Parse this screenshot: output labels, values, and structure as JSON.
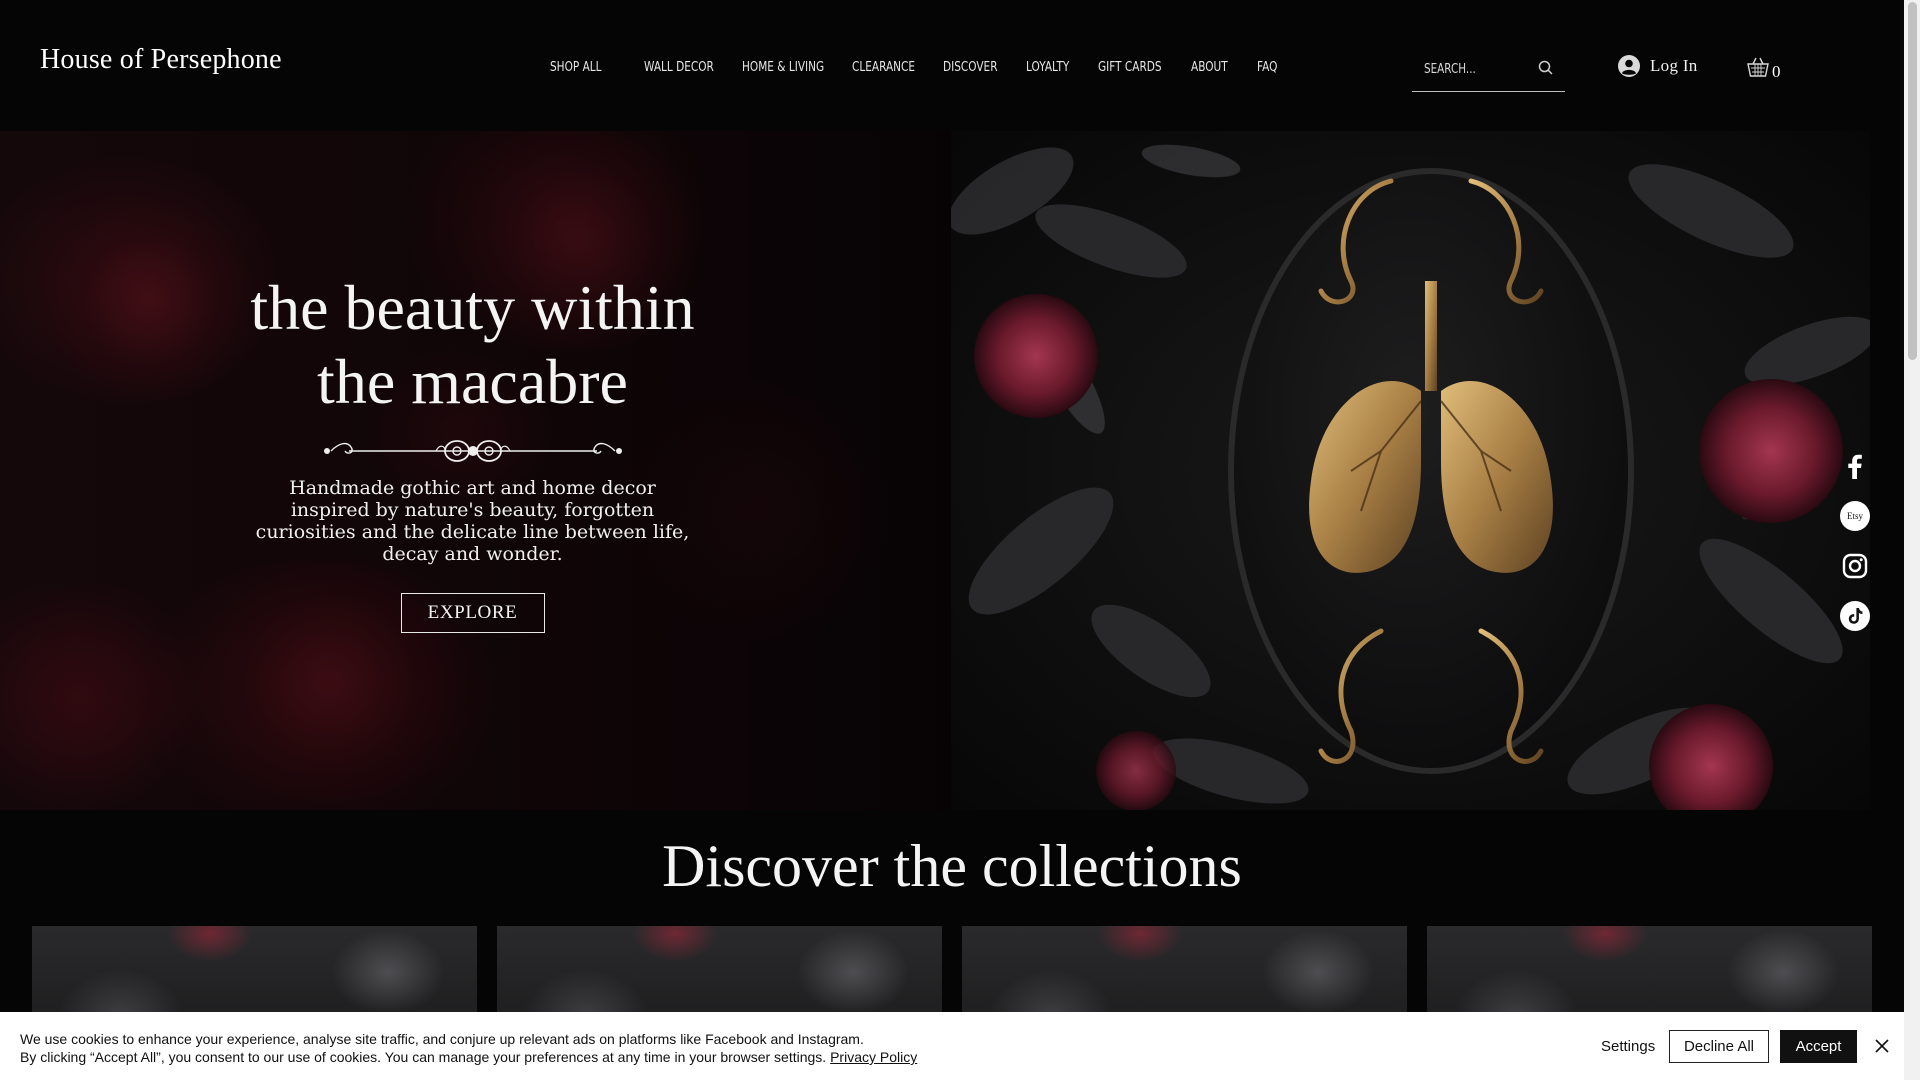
{
  "header": {
    "logo": "House of Persephone",
    "nav": [
      "SHOP ALL",
      "WALL DECOR",
      "HOME & LIVING",
      "CLEARANCE",
      "DISCOVER",
      "LOYALTY",
      "GIFT CARDS",
      "ABOUT",
      "FAQ"
    ],
    "search_placeholder": "SEARCH...",
    "login_label": "Log In",
    "cart_count": "0"
  },
  "hero": {
    "title_line1": "the beauty within",
    "title_line2": "the macabre",
    "subtitle": "Handmade gothic art and home decor inspired by nature's beauty, forgotten curiosities and the delicate line between life, decay and wonder.",
    "cta_label": "EXPLORE"
  },
  "social": {
    "icons": [
      "facebook-icon",
      "etsy-icon",
      "instagram-icon",
      "tiktok-icon"
    ],
    "etsy_text": "Etsy"
  },
  "collections": {
    "title": "Discover the collections",
    "card_count": 4
  },
  "cookie": {
    "line1": "We use cookies to enhance your experience, analyse site traffic, and conjure up relevant ads on platforms like Facebook and Instagram.",
    "line2": "By clicking “Accept All”, you consent to our use of cookies. You can manage your preferences at any time in your browser settings.",
    "privacy_link": "Privacy Policy",
    "settings_label": "Settings",
    "decline_label": "Decline All",
    "accept_label": "Accept"
  },
  "colors": {
    "background": "#050505",
    "text": "#ffffff",
    "accent_gold": "#b8935a",
    "accent_rose": "#6b1a26"
  }
}
